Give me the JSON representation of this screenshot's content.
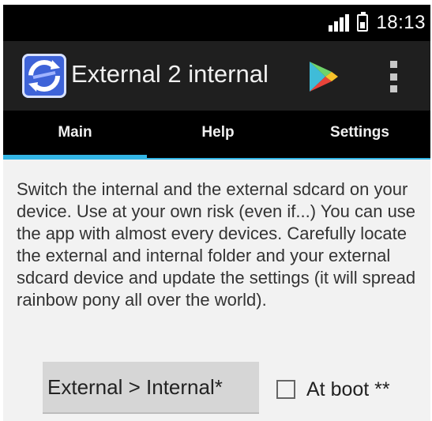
{
  "status_bar": {
    "time": "18:13",
    "signal_icon": "signal-bars-icon",
    "battery_icon": "battery-icon"
  },
  "action_bar": {
    "app_icon": "sync-arrows-icon",
    "title": "External 2 internal",
    "play_store_icon": "play-store-icon",
    "overflow_icon": "overflow-menu-icon"
  },
  "tabs": [
    {
      "label": "Main",
      "selected": true
    },
    {
      "label": "Help",
      "selected": false
    },
    {
      "label": "Settings",
      "selected": false
    }
  ],
  "main": {
    "description": "Switch the internal and the external sdcard on your device. Use at your own risk (even if...) You can use the app with almost every devices. Carefully locate the external and internal folder and your external sdcard device and update the settings (it will spread rainbow pony all over the world).",
    "switch_button_label": "External > Internal*",
    "at_boot_label": "At boot **",
    "at_boot_checked": false
  },
  "colors": {
    "tab_indicator": "#33b5e5",
    "action_bar_bg": "#1f1f1f",
    "status_bar_bg": "#000000",
    "content_bg": "#f2f2f2"
  }
}
